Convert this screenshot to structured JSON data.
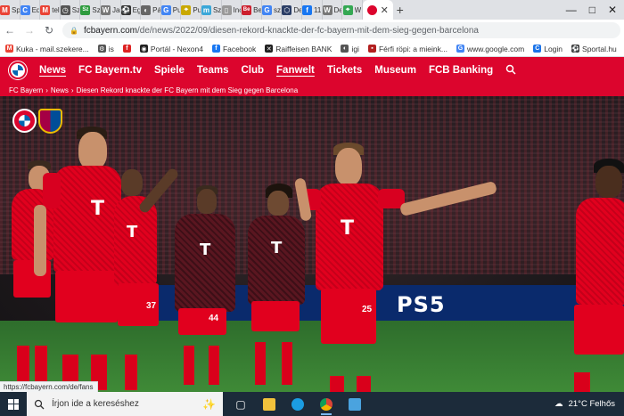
{
  "browser": {
    "tabs": [
      {
        "label": "Sp",
        "icon": "gmail-icon",
        "color": "#ea4335",
        "glyph": "M"
      },
      {
        "label": "Ed",
        "icon": "g-icon",
        "color": "#4285f4",
        "glyph": "C"
      },
      {
        "label": "tel",
        "icon": "gmail-icon",
        "color": "#ea4335",
        "glyph": "M"
      },
      {
        "label": "Sz",
        "icon": "clock-icon",
        "color": "#555555",
        "glyph": "◷"
      },
      {
        "label": "Sz",
        "icon": "sz-icon",
        "color": "#2e9b3e",
        "glyph": "Sz"
      },
      {
        "label": "Jai",
        "icon": "wikipedia-icon",
        "color": "#777777",
        "glyph": "W"
      },
      {
        "label": "Eg",
        "icon": "soccer-icon",
        "color": "#333333",
        "glyph": "⚽"
      },
      {
        "label": "Pá",
        "icon": "globe-icon",
        "color": "#666666",
        "glyph": "◐"
      },
      {
        "label": "Pu",
        "icon": "google-icon",
        "color": "#4285f4",
        "glyph": "G"
      },
      {
        "label": "Pu",
        "icon": "pin-icon",
        "color": "#c9a800",
        "glyph": "⌖"
      },
      {
        "label": "Sz",
        "icon": "sz-icon",
        "color": "#3aa7d8",
        "glyph": "m"
      },
      {
        "label": "Inc",
        "icon": "doc-icon",
        "color": "#999999",
        "glyph": "▯"
      },
      {
        "label": "Be",
        "icon": "be-icon",
        "color": "#cc1f2d",
        "glyph": "Be"
      },
      {
        "label": "sz",
        "icon": "google-icon",
        "color": "#4285f4",
        "glyph": "G"
      },
      {
        "label": "De",
        "icon": "hex-icon",
        "color": "#2b3e66",
        "glyph": "⬡"
      },
      {
        "label": "11",
        "icon": "facebook-icon",
        "color": "#1877f2",
        "glyph": "f"
      },
      {
        "label": "De",
        "icon": "wikipedia-icon",
        "color": "#777777",
        "glyph": "W"
      },
      {
        "label": "W",
        "icon": "maps-icon",
        "color": "#34a853",
        "glyph": "⌖"
      }
    ],
    "active_tab": {
      "icon": "fcbayern-icon",
      "close": "✕"
    },
    "new_tab": "+",
    "window": {
      "minimize": "—",
      "maximize": "□",
      "close": "✕"
    },
    "url_host": "fcbayern.com",
    "url_path": "/de/news/2022/09/diesen-rekord-knackte-der-fc-bayern-mit-dem-sieg-gegen-barcelona",
    "bookmarks": [
      {
        "label": "Kuka - mail.szekere...",
        "icon": "gmail-icon",
        "color": "#ea4335",
        "glyph": "M"
      },
      {
        "label": "is",
        "icon": "settings-icon",
        "color": "#555555",
        "glyph": "⚙"
      },
      {
        "label": "",
        "icon": "facebook-icon",
        "color": "#dd2222",
        "glyph": "f"
      },
      {
        "label": "Portál - Nexon4",
        "icon": "nexon-icon",
        "color": "#222222",
        "glyph": "◉"
      },
      {
        "label": "Facebook",
        "icon": "facebook-icon",
        "color": "#1877f2",
        "glyph": "f"
      },
      {
        "label": "Raiffeisen BANK",
        "icon": "raiffeisen-icon",
        "color": "#222222",
        "glyph": "✕"
      },
      {
        "label": "igi",
        "icon": "globe-icon",
        "color": "#555555",
        "glyph": "◐"
      },
      {
        "label": "Férfi röpi: a mieink...",
        "icon": "news-icon",
        "color": "#b21f1f",
        "glyph": "▪"
      },
      {
        "label": "www.google.com",
        "icon": "google-icon",
        "color": "#4285f4",
        "glyph": "G"
      },
      {
        "label": "Login",
        "icon": "login-icon",
        "color": "#1a73e8",
        "glyph": "C"
      },
      {
        "label": "Sportal.hu",
        "icon": "soccer-icon",
        "color": "#333333",
        "glyph": "⚽"
      }
    ]
  },
  "site": {
    "nav": [
      "News",
      "FC Bayern.tv",
      "Spiele",
      "Teams",
      "Club",
      "Fanwelt",
      "Tickets",
      "Museum",
      "FCB Banking"
    ],
    "breadcrumb": [
      "FC Bayern",
      "News",
      "Diesen Rekord knackte der FC Bayern mit dem Sieg gegen Barcelona"
    ],
    "ad": "PS5",
    "shirt_letter": "T",
    "numbers": [
      "37",
      "44",
      "25"
    ],
    "status_link": "https://fcbayern.com/de/fans"
  },
  "taskbar": {
    "search_placeholder": "Írjon ide a kereséshez",
    "weather": "21°C  Felhős"
  }
}
